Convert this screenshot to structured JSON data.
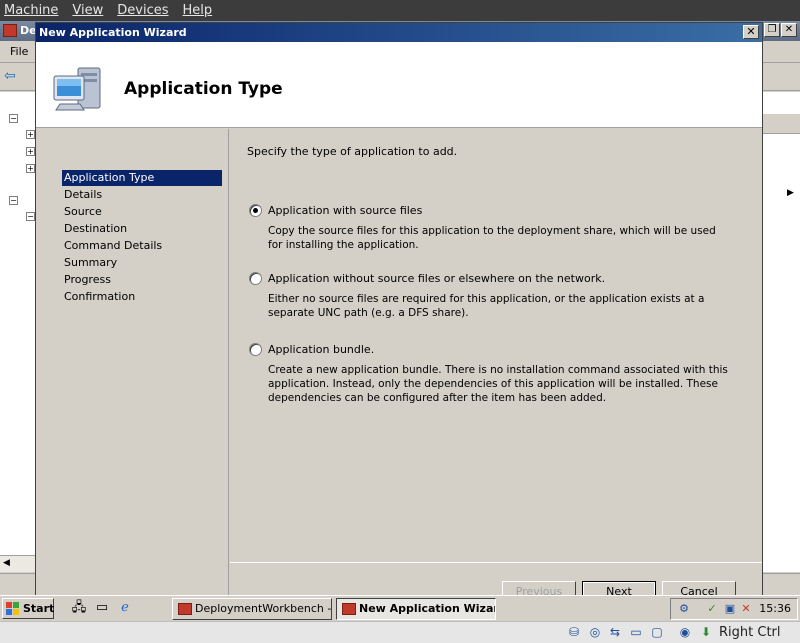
{
  "host_menu": {
    "items": [
      "Machine",
      "View",
      "Devices",
      "Help"
    ]
  },
  "background_window": {
    "title": "De",
    "menu_file": "File"
  },
  "wizard": {
    "title": "New Application Wizard",
    "close_glyph": "✕",
    "heading": "Application Type",
    "nav": [
      "Application Type",
      "Details",
      "Source",
      "Destination",
      "Command Details",
      "Summary",
      "Progress",
      "Confirmation"
    ],
    "prompt": "Specify the type of application to add.",
    "options": [
      {
        "label": "Application with source files",
        "description": "Copy the source files for this application to the deployment share, which will be used for installing the application.",
        "checked": true
      },
      {
        "label": "Application without source files or elsewhere on the network.",
        "description": "Either no source files are required for this application, or the application exists at a separate UNC path (e.g. a DFS share).",
        "checked": false
      },
      {
        "label": "Application bundle.",
        "description": "Create a new application bundle.  There is no installation command associated with this application.  Instead, only the dependencies of this application will be installed.  These dependencies can be configured after the item has been added.",
        "checked": false
      }
    ],
    "buttons": {
      "previous": "Previous",
      "next": "Next",
      "cancel": "Cancel"
    }
  },
  "taskbar": {
    "start": "Start",
    "tasks": [
      "DeploymentWorkbench -...",
      "New Application Wizard"
    ],
    "clock": "15:36"
  },
  "vbox_status": {
    "host_key": "Right Ctrl"
  },
  "colors": {
    "titlebar": "#0a246a",
    "selection": "#0a246a",
    "face": "#d4d0c8"
  }
}
